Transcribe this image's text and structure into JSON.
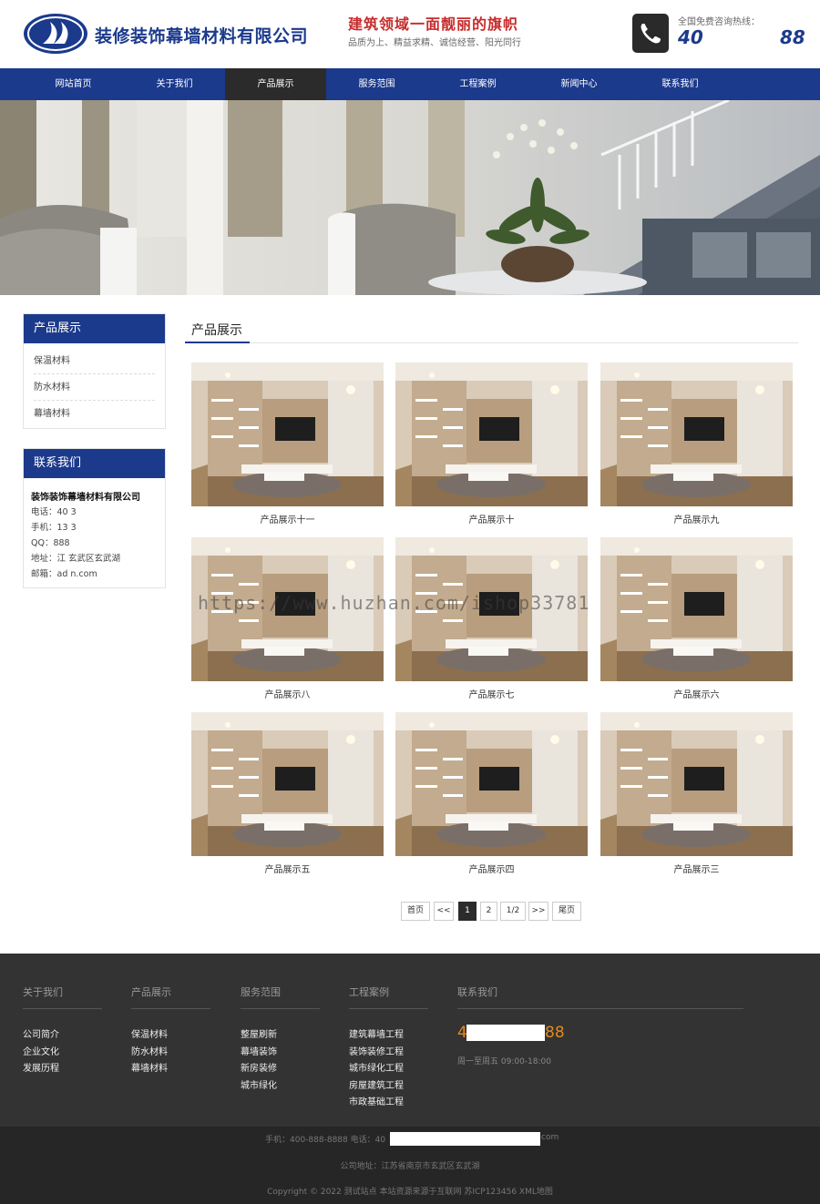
{
  "header": {
    "company_name": "装修装饰幕墙材料有限公司",
    "slogan": "建筑领域一面靓丽的旗帜",
    "sub_slogan": "品质为上、精益求精、诚信经营、阳光同行",
    "hotline_label": "全国免费咨询热线：",
    "hotline_prefix": "40",
    "hotline_suffix": "88"
  },
  "nav": {
    "items": [
      "网站首页",
      "关于我们",
      "产品展示",
      "服务范围",
      "工程案例",
      "新闻中心",
      "联系我们"
    ],
    "active_index": 2
  },
  "sidebar": {
    "products": {
      "title": "产品展示",
      "items": [
        "保温材料",
        "防水材料",
        "幕墙材料"
      ]
    },
    "contact": {
      "title": "联系我们",
      "company": "装饰装饰幕墙材料有限公司",
      "phone": "电话：40               3",
      "mobile": "手机：13               3",
      "qq": "QQ：888",
      "address": "地址：江               玄武区玄武湖",
      "email": "邮箱：ad               n.com"
    }
  },
  "main": {
    "title": "产品展示",
    "products": [
      "产品展示十一",
      "产品展示十",
      "产品展示九",
      "产品展示八",
      "产品展示七",
      "产品展示六",
      "产品展示五",
      "产品展示四",
      "产品展示三"
    ]
  },
  "pagination": {
    "first": "首页",
    "prev": "<<",
    "page1": "1",
    "page2": "2",
    "info": "1/2",
    "next": ">>",
    "last": "尾页"
  },
  "watermark": "https://www.huzhan.com/ishop33781",
  "footer": {
    "columns": [
      {
        "title": "关于我们",
        "links": [
          "公司简介",
          "企业文化",
          "发展历程"
        ]
      },
      {
        "title": "产品展示",
        "links": [
          "保温材料",
          "防水材料",
          "幕墙材料"
        ]
      },
      {
        "title": "服务范围",
        "links": [
          "整屋刷新",
          "幕墙装饰",
          "新房装修",
          "城市绿化"
        ]
      },
      {
        "title": "工程案例",
        "links": [
          "建筑幕墙工程",
          "装饰装修工程",
          "城市绿化工程",
          "房屋建筑工程",
          "市政基础工程"
        ]
      }
    ],
    "contact_title": "联系我们",
    "contact_phone_prefix": "4",
    "contact_phone_suffix": "88",
    "hours": "周一至周五 09:00-18:00",
    "bottom_line1_prefix": "手机：400-888-8888  电话：40",
    "bottom_line1_suffix": "com",
    "bottom_line2": "公司地址：江苏省南京市玄武区玄武湖",
    "bottom_line3": "Copyright © 2022 测试站点 本站资源来源于互联网  苏ICP123456 XML地图"
  },
  "colors": {
    "brand_blue": "#1c3a8c",
    "dark": "#2b2b2b",
    "footer_bg": "#333333",
    "bottom_bg": "#262626",
    "phone_orange": "#e48a1c"
  }
}
